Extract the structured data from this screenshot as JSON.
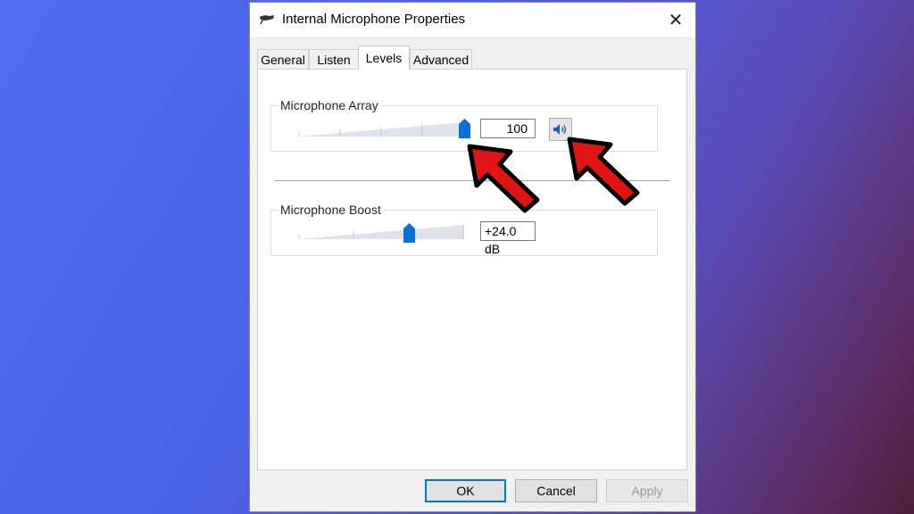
{
  "dialog": {
    "title": "Internal Microphone Properties",
    "close_label": "✕",
    "tabs": [
      {
        "label": "General"
      },
      {
        "label": "Listen"
      },
      {
        "label": "Levels"
      },
      {
        "label": "Advanced"
      }
    ],
    "active_tab": "Levels"
  },
  "levels": {
    "microphone_array": {
      "label": "Microphone Array",
      "value": "100",
      "slider_fraction": 1.0
    },
    "microphone_boost": {
      "label": "Microphone Boost",
      "value": "+24.0 dB",
      "slider_fraction": 0.66
    }
  },
  "buttons": {
    "ok": "OK",
    "cancel": "Cancel",
    "apply": "Apply"
  },
  "annotation_color": "#e01414"
}
